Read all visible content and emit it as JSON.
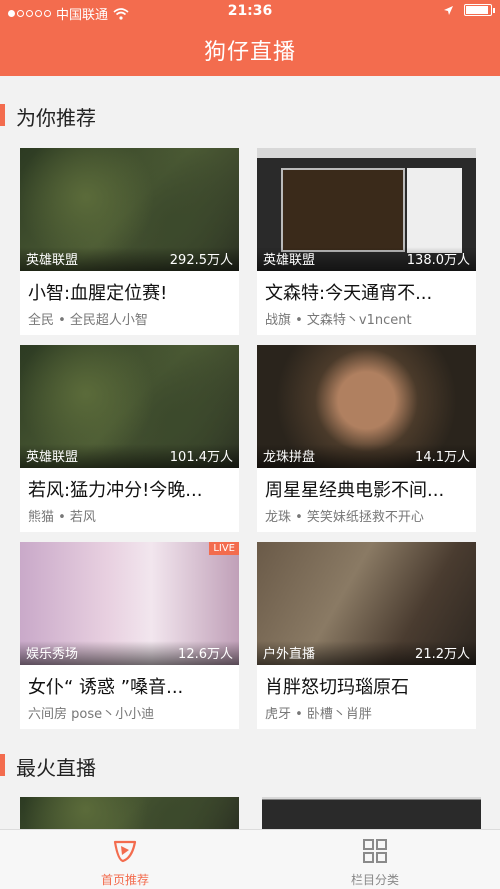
{
  "status": {
    "carrier": "中国联通",
    "time": "21:36"
  },
  "nav": {
    "title": "狗仔直播"
  },
  "sections": {
    "recommended": "为你推荐",
    "hottest": "最火直播"
  },
  "cards": [
    {
      "category": "英雄联盟",
      "views": "292.5万人",
      "title": "小智:血腥定位赛!",
      "subtitle": "全民 • 全民超人小智",
      "thumb_style": "lol"
    },
    {
      "category": "英雄联盟",
      "views": "138.0万人",
      "title": "文森特:今天通宵不...",
      "subtitle": "战旗 • 文森特丶v1ncent",
      "thumb_style": "screen"
    },
    {
      "category": "英雄联盟",
      "views": "101.4万人",
      "title": "若风:猛力冲分!今晚...",
      "subtitle": "熊猫 • 若风",
      "thumb_style": "lol"
    },
    {
      "category": "龙珠拼盘",
      "views": "14.1万人",
      "title": "周星星经典电影不间...",
      "subtitle": "龙珠 • 笑笑妹纸拯救不开心",
      "thumb_style": "face"
    },
    {
      "category": "娱乐秀场",
      "views": "12.6万人",
      "title": "女仆“ 诱惑 ”嗓音...",
      "subtitle": "六间房 pose丶小小迪",
      "thumb_style": "maid",
      "badge": "LIVE"
    },
    {
      "category": "户外直播",
      "views": "21.2万人",
      "title": "肖胖怒切玛瑙原石",
      "subtitle": "虎牙 • 卧槽丶肖胖",
      "thumb_style": "craft"
    }
  ],
  "tabs": [
    {
      "label": "首页推荐",
      "icon": "play-logo-icon",
      "active": true
    },
    {
      "label": "栏目分类",
      "icon": "grid-icon",
      "active": false
    }
  ],
  "colors": {
    "accent": "#f36c4e",
    "background": "#f2f2f2"
  }
}
